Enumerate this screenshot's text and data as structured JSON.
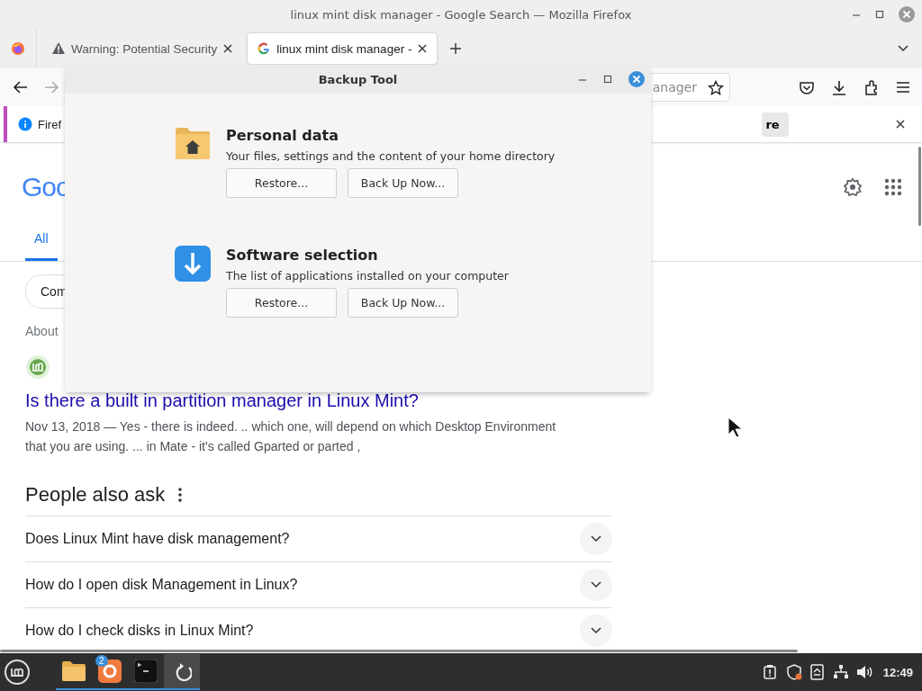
{
  "window": {
    "title": "linux mint disk manager - Google Search — Mozilla Firefox"
  },
  "tabs": [
    {
      "kind": "warning",
      "label": "Warning: Potential Security",
      "selected": false
    },
    {
      "kind": "google",
      "label": "linux mint disk manager -",
      "selected": true
    }
  ],
  "address_bar": {
    "value": "anager"
  },
  "notification": {
    "text_start": "Firef",
    "text_end": "re"
  },
  "page": {
    "logo": "Goo",
    "tabs": [
      {
        "label": "All",
        "selected": true
      }
    ],
    "chip": "Com",
    "result_count": "About",
    "result": {
      "title": "Is there a built in partition manager in Linux Mint?",
      "snippet": "Nov 13, 2018 — Yes - there is indeed. .. which one, will depend on which Desktop Environment that you are using. ... in Mate - it's called Gparted or parted ,"
    },
    "people_also_ask": {
      "heading": "People also ask",
      "questions": [
        "Does Linux Mint have disk management?",
        "How do I open disk Management in Linux?",
        "How do I check disks in Linux Mint?"
      ]
    }
  },
  "dialog": {
    "title": "Backup Tool",
    "sections": [
      {
        "kind": "folder",
        "title": "Personal data",
        "description": "Your files, settings and the content of your home directory",
        "buttons": [
          "Restore...",
          "Back Up Now..."
        ]
      },
      {
        "kind": "software",
        "title": "Software selection",
        "description": "The list of applications installed on your computer",
        "buttons": [
          "Restore...",
          "Back Up Now..."
        ]
      }
    ]
  },
  "taskbar": {
    "items": [
      {
        "kind": "files",
        "selected": false
      },
      {
        "kind": "firefox",
        "badge": "2",
        "selected": false
      },
      {
        "kind": "terminal",
        "selected": false
      },
      {
        "kind": "backup",
        "selected": true
      }
    ],
    "clock": "12:49"
  }
}
